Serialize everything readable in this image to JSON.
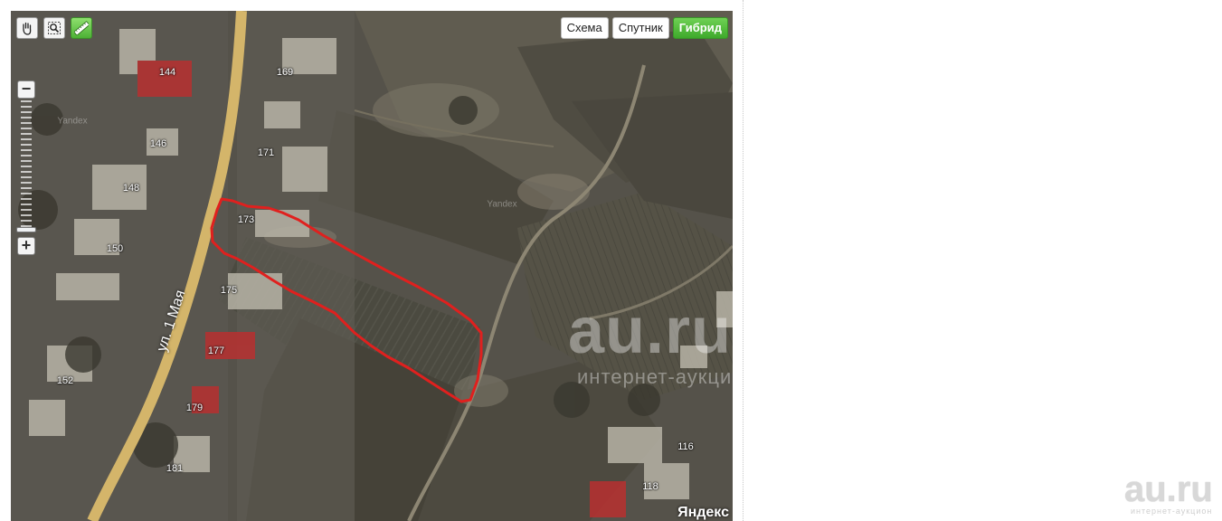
{
  "map": {
    "map_types": [
      {
        "label": "Схема",
        "active": false
      },
      {
        "label": "Спутник",
        "active": false
      },
      {
        "label": "Гибрид",
        "active": true
      }
    ],
    "tools": [
      {
        "icon": "hand-icon"
      },
      {
        "icon": "magnifier-icon"
      },
      {
        "icon": "ruler-icon"
      }
    ],
    "zoom": {
      "in": "+",
      "out": "−",
      "level_fraction": 0.93
    },
    "street_label": "ул. 1 Мая",
    "house_labels": [
      "144",
      "169",
      "146",
      "171",
      "148",
      "173",
      "150",
      "175",
      "177",
      "152",
      "179",
      "181",
      "116",
      "118"
    ],
    "imagery_watermark": "Yandex",
    "provider_logo": "Яндекс"
  },
  "site_watermark": {
    "text": "au.ru",
    "subtext": "интернет-аукцион"
  },
  "colors": {
    "outline": "#e0201e",
    "road": "#d4b56a",
    "active_button": "#4cb135"
  }
}
